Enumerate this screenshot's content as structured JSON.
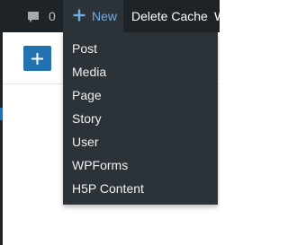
{
  "admin_bar": {
    "comments": {
      "icon": "comment-icon",
      "count": "0"
    },
    "new": {
      "icon": "plus-icon",
      "label": "New"
    },
    "delete_cache_label": "Delete Cache",
    "overflow_label": "W"
  },
  "new_menu": {
    "items": [
      {
        "label": "Post"
      },
      {
        "label": "Media"
      },
      {
        "label": "Page"
      },
      {
        "label": "Story"
      },
      {
        "label": "User"
      },
      {
        "label": "WPForms"
      },
      {
        "label": "H5P Content"
      }
    ]
  },
  "editor": {
    "inserter_icon": "plus-icon"
  },
  "colors": {
    "admin_bar_bg": "#1d2327",
    "menu_bg": "#2c3338",
    "accent_blue": "#72aee6",
    "button_blue": "#2271b1"
  }
}
